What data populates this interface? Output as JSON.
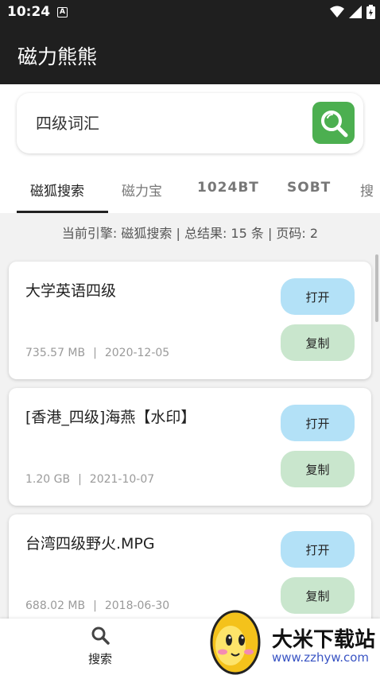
{
  "status_bar": {
    "time": "10:24",
    "notification_badge": "A"
  },
  "app_bar": {
    "title": "磁力熊熊"
  },
  "search": {
    "value": "四级词汇"
  },
  "tabs": [
    {
      "label": "磁狐搜索",
      "active": true
    },
    {
      "label": "磁力宝",
      "active": false
    },
    {
      "label": "1024BT",
      "active": false
    },
    {
      "label": "SOBT",
      "active": false
    },
    {
      "label": "搜",
      "active": false
    }
  ],
  "info": {
    "text": "当前引擎: 磁狐搜索 | 总结果: 15 条 | 页码: 2"
  },
  "results": [
    {
      "title": "大学英语四级",
      "size": "735.57 MB",
      "date": "2020-12-05",
      "separator": "|",
      "open_label": "打开",
      "copy_label": "复制"
    },
    {
      "title": "[香港_四级]海燕【水印】",
      "size": "1.20 GB",
      "date": "2021-10-07",
      "separator": "|",
      "open_label": "打开",
      "copy_label": "复制"
    },
    {
      "title": "台湾四级野火.MPG",
      "size": "688.02 MB",
      "date": "2018-06-30",
      "separator": "|",
      "open_label": "打开",
      "copy_label": "复制"
    }
  ],
  "bottom_nav": {
    "search_label": "搜索"
  },
  "watermark": {
    "brand": "大米下载站",
    "url": "www.zzhyw.com"
  },
  "colors": {
    "app_bar": "#1f1f1f",
    "search_button": "#4caf50",
    "open_button": "#b3e1f7",
    "copy_button": "#c9e6cd"
  }
}
